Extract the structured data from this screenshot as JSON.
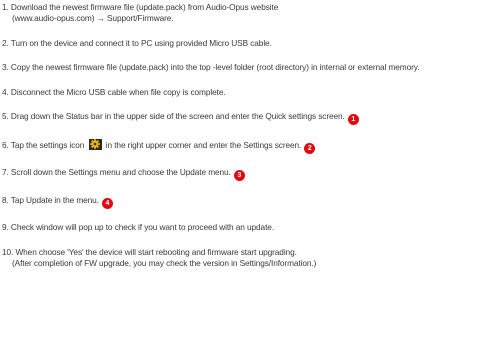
{
  "steps": [
    {
      "line1": "1. Download the newest firmware file (update.pack) from Audio-Opus website",
      "line2": "(www.audio-opus.com) → Support/Firmware."
    },
    {
      "text": "2. Turn on the device and connect it to PC using provided Micro USB cable."
    },
    {
      "text": "3. Copy the newest firmware file (update.pack) into the top -level folder (root directory) in internal or external memory."
    },
    {
      "text": "4.  Disconnect the Micro USB cable when file copy is complete."
    },
    {
      "text": "5. Drag down the Status bar in the upper side of the screen and enter the Quick settings screen.",
      "badge": "1"
    },
    {
      "pre": "6. Tap the settings icon",
      "icon": "settings-gear-icon",
      "post": "in the right upper corner and enter the Settings screen.",
      "badge": "2"
    },
    {
      "text": "7. Scroll down the Settings menu and choose the Update menu.",
      "badge": "3"
    },
    {
      "text": "8. Tap Update in the menu.",
      "badge": "4"
    },
    {
      "text": "9. Check window will pop up to check if you want to proceed with an update."
    },
    {
      "line1": "10. When choose 'Yes' the device will start rebooting and firmware start upgrading.",
      "line2": "(After completion of FW upgrade, you may check the version in Settings/Information.)"
    }
  ],
  "colors": {
    "text": "#3a3a3a",
    "badge": "#e30613",
    "gear": "#e8b800",
    "gear_bg": "#2b2b2b"
  }
}
